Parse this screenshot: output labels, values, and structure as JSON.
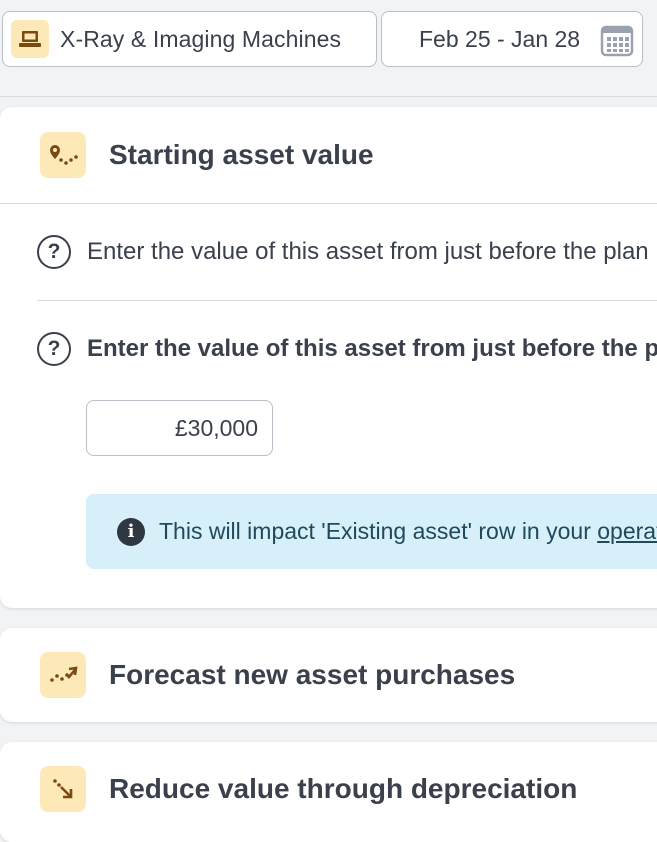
{
  "header": {
    "asset_label": "X-Ray & Imaging Machines",
    "asset_icon": "machine-icon",
    "date_range": "Feb 25 - Jan 28",
    "calendar_icon": "calendar-icon"
  },
  "starting_value": {
    "title": "Starting asset value",
    "icon": "route-pin-icon",
    "question_1": "Enter the value of this asset from just before the plan",
    "question_2": "Enter the value of this asset from just before the plan",
    "value": "£30,000",
    "info_text": "This will impact 'Existing asset' row in your ",
    "info_link": "operating"
  },
  "purchases": {
    "title": "Forecast new asset purchases",
    "icon": "trend-up-icon"
  },
  "depreciation": {
    "title": "Reduce value through depreciation",
    "icon": "trend-down-icon"
  },
  "colors": {
    "accent_bg": "#fde9b8",
    "icon_brown": "#7a4a12",
    "info_bg": "#d6eff9"
  }
}
